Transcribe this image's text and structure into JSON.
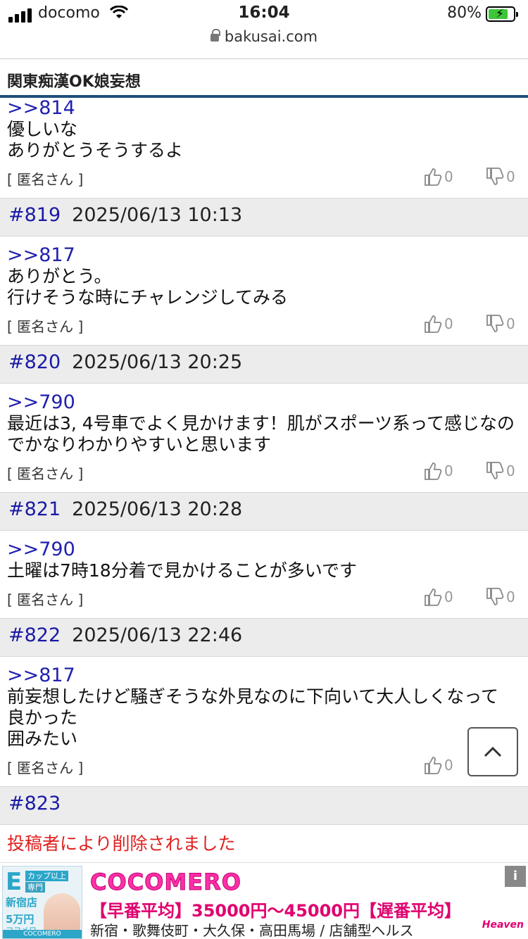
{
  "status_bar": {
    "carrier": "docomo",
    "time": "16:04",
    "battery": "80%",
    "battery_level": 0.8
  },
  "url_bar": {
    "domain": "bakusai.com"
  },
  "board": {
    "title": "関東痴漢OK娘妄想"
  },
  "posts": [
    {
      "number": "",
      "date": "",
      "reply": ">>814",
      "text": "優しいな\nありがとうそうするよ",
      "poster": "[ 匿名さん ]",
      "likes": "0",
      "dislikes": "0"
    },
    {
      "number": "#819",
      "date": "2025/06/13 10:13",
      "reply": ">>817",
      "text": "ありがとう。\n行けそうな時にチャレンジしてみる",
      "poster": "[ 匿名さん ]",
      "likes": "0",
      "dislikes": "0"
    },
    {
      "number": "#820",
      "date": "2025/06/13 20:25",
      "reply": ">>790",
      "text": "最近は3, 4号車でよく見かけます！肌がスポーツ系って感じなの\nでかなりわかりやすいと思います",
      "poster": "[ 匿名さん ]",
      "likes": "0",
      "dislikes": "0"
    },
    {
      "number": "#821",
      "date": "2025/06/13 20:28",
      "reply": ">>790",
      "text": "土曜は7時18分着で見かけることが多いです",
      "poster": "[ 匿名さん ]",
      "likes": "0",
      "dislikes": "0"
    },
    {
      "number": "#822",
      "date": "2025/06/13 22:46",
      "reply": ">>817",
      "text": "前妄想したけど騒ぎそうな外見なのに下向いて大人しくなって\n良かった\n囲みたい",
      "poster": "[ 匿名さん ]",
      "likes": "0",
      "dislikes": "0"
    },
    {
      "number": "#823",
      "date": "",
      "deleted_text": "投稿者により削除されました"
    }
  ],
  "ad": {
    "title": "COCOMERO",
    "price_line": "【早番平均】35000円～45000円【遅番平均】",
    "area_line": "新宿・歌舞伎町・大久保・高田馬場 / 店舗型ヘルス",
    "thumb": {
      "big_letter": "E",
      "tag1": "カップ以上",
      "tag2": "専門",
      "shop": "新宿店",
      "price": "5万円",
      "brand_jp": "ココメロ",
      "brand_en": "COCOMERO"
    },
    "corner_label": "i",
    "badge": "Heaven"
  },
  "colors": {
    "post_number": "#1a1aa6",
    "reply_link": "#2020b0",
    "deleted": "#e02020",
    "header_bar": "#1e4f7a",
    "ad_pink": "#ff2fa8"
  }
}
